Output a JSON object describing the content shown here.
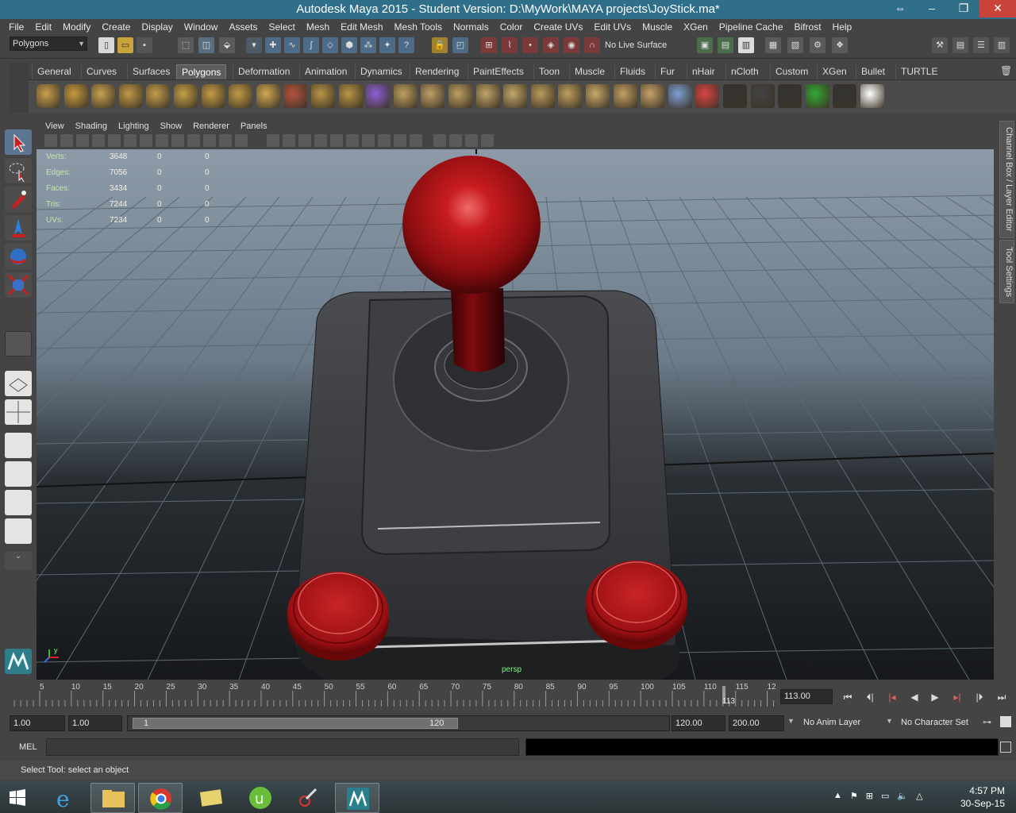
{
  "window": {
    "title": "Autodesk Maya 2015 - Student Version: D:\\MyWork\\MAYA projects\\JoyStick.ma*"
  },
  "menubar": [
    "File",
    "Edit",
    "Modify",
    "Create",
    "Display",
    "Window",
    "Assets",
    "Select",
    "Mesh",
    "Edit Mesh",
    "Mesh Tools",
    "Normals",
    "Color",
    "Create UVs",
    "Edit UVs",
    "Muscle",
    "XGen",
    "Pipeline Cache",
    "Bifrost",
    "Help"
  ],
  "statusline": {
    "mode": "Polygons",
    "live_surface": "No Live Surface"
  },
  "shelf_tabs": [
    "General",
    "Curves",
    "Surfaces",
    "Polygons",
    "Deformation",
    "Animation",
    "Dynamics",
    "Rendering",
    "PaintEffects",
    "Toon",
    "Muscle",
    "Fluids",
    "Fur",
    "nHair",
    "nCloth",
    "Custom",
    "XGen",
    "Bullet",
    "TURTLE"
  ],
  "active_shelf_tab": "Polygons",
  "viewport": {
    "menus": [
      "View",
      "Shading",
      "Lighting",
      "Show",
      "Renderer",
      "Panels"
    ],
    "hud": [
      {
        "label": "Verts:",
        "a": "3648",
        "b": "0",
        "c": "0"
      },
      {
        "label": "Edges:",
        "a": "7056",
        "b": "0",
        "c": "0"
      },
      {
        "label": "Faces:",
        "a": "3434",
        "b": "0",
        "c": "0"
      },
      {
        "label": "Tris:",
        "a": "7244",
        "b": "0",
        "c": "0"
      },
      {
        "label": "UVs:",
        "a": "7234",
        "b": "0",
        "c": "0"
      }
    ],
    "camera": "persp",
    "axis_y": "y"
  },
  "right_panel": {
    "tab1": "Channel Box / Layer Editor",
    "tab2": "Tool Settings"
  },
  "timeline": {
    "ticks": [
      "5",
      "10",
      "15",
      "20",
      "25",
      "30",
      "35",
      "40",
      "45",
      "50",
      "55",
      "60",
      "65",
      "70",
      "75",
      "80",
      "85",
      "90",
      "95",
      "100",
      "105",
      "110",
      "115",
      "12"
    ],
    "current_marker": "113",
    "current_time": "113.00"
  },
  "range": {
    "start_time": "1.00",
    "playback_start": "1.00",
    "slider_start": "1",
    "slider_end": "120",
    "playback_end": "120.00",
    "end_time": "200.00",
    "anim_layer": "No Anim Layer",
    "char_set": "No Character Set"
  },
  "mel": {
    "label": "MEL"
  },
  "helpline": "Select Tool: select an object",
  "taskbar": {
    "time": "4:57 PM",
    "date": "30-Sep-15"
  },
  "colors": {
    "title_bg": "#2f6f8a",
    "accent_red": "#8c0f12"
  }
}
